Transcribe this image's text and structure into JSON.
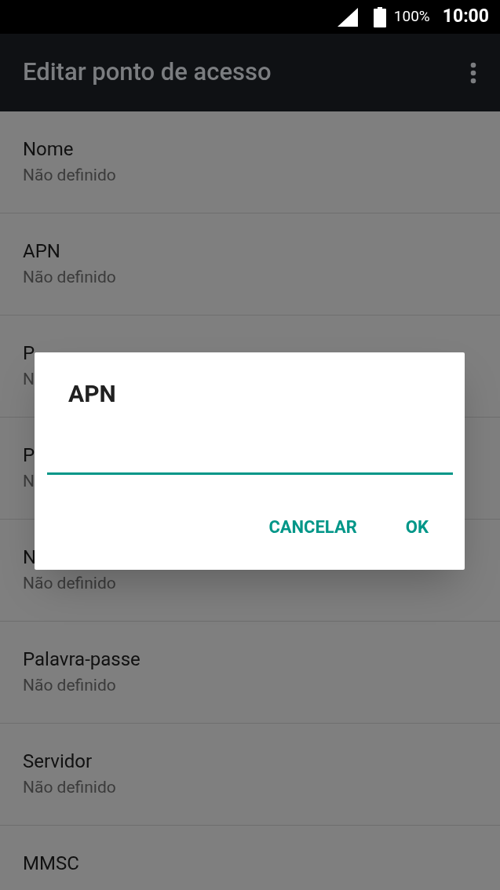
{
  "status_bar": {
    "battery": "100%",
    "time": "10:00"
  },
  "app_bar": {
    "title": "Editar ponto de acesso"
  },
  "settings": [
    {
      "label": "Nome",
      "value": "Não definido"
    },
    {
      "label": "APN",
      "value": "Não definido"
    },
    {
      "label": "P",
      "value": "N"
    },
    {
      "label": "P",
      "value": "N"
    },
    {
      "label": "N",
      "value": "Não definido"
    },
    {
      "label": "Palavra-passe",
      "value": "Não definido"
    },
    {
      "label": "Servidor",
      "value": "Não definido"
    },
    {
      "label": "MMSC"
    }
  ],
  "dialog": {
    "title": "APN",
    "buttons": [
      "CANCELAR",
      "OK"
    ]
  }
}
